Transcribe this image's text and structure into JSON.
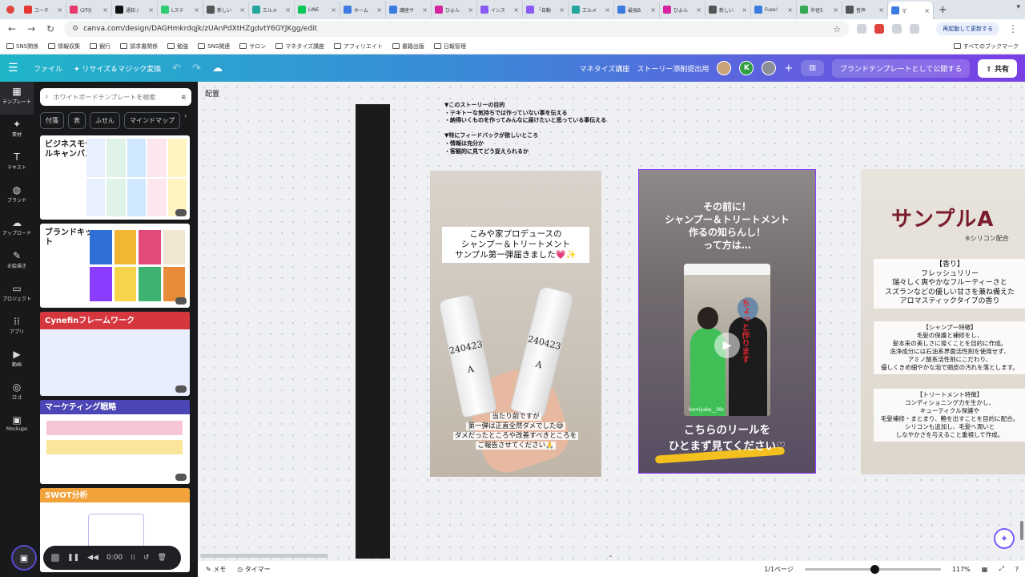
{
  "browser": {
    "tabs": [
      {
        "label": "ユーチ",
        "color": "#e53935"
      },
      {
        "label": "(2刊)",
        "color": "#e53970"
      },
      {
        "label": "通知 /",
        "color": "#111111"
      },
      {
        "label": "Lステ",
        "color": "#2ecc71"
      },
      {
        "label": "新しい",
        "color": "#555555"
      },
      {
        "label": "エルメ",
        "color": "#26a69a"
      },
      {
        "label": "LINE",
        "color": "#06c755"
      },
      {
        "label": "ホーム",
        "color": "#3d7be0"
      },
      {
        "label": "講座サ",
        "color": "#3d7be0"
      },
      {
        "label": "ひよん",
        "color": "#d6249f"
      },
      {
        "label": "インス",
        "color": "#8a5cf6"
      },
      {
        "label": "「自動",
        "color": "#8a5cf6"
      },
      {
        "label": "エルメ",
        "color": "#26a69a"
      },
      {
        "label": "最強B",
        "color": "#3d7be0"
      },
      {
        "label": "ひよん",
        "color": "#d6249f"
      },
      {
        "label": "新しい",
        "color": "#555555"
      },
      {
        "label": "Fuse!",
        "color": "#3d7be0"
      },
      {
        "label": "半径5",
        "color": "#34a853"
      },
      {
        "label": "音声",
        "color": "#555555"
      },
      {
        "label": "マ",
        "color": "#3d7be0"
      }
    ],
    "url": "canva.com/design/DAGHmkrdqjk/zUAnPdXtHZgdvtY6GYJKgg/edit",
    "restart_label": "再起動して更新する",
    "bookmarks": [
      "SNS関係",
      "情報収集",
      "銀行",
      "請求書関係",
      "勉強",
      "SNS関連",
      "サロン",
      "マネタイズ講座",
      "アフィリエイト",
      "書籍出版",
      "日報管理"
    ],
    "all_bookmarks": "すべてのブックマーク"
  },
  "header": {
    "file": "ファイル",
    "resize": "リサイズ＆マジック変換",
    "project": "マネタイズ講座　ストーリー添削提出用",
    "avatar_k": "K",
    "publish": "ブランドテンプレートとして公開する",
    "share": "共有"
  },
  "rail": [
    {
      "label": "テンプレート",
      "icon": "layout-icon",
      "glyph": "▦"
    },
    {
      "label": "素材",
      "icon": "shapes-icon",
      "glyph": "✦"
    },
    {
      "label": "テキスト",
      "icon": "text-icon",
      "glyph": "T"
    },
    {
      "label": "ブランド",
      "icon": "brand-icon",
      "glyph": "◍"
    },
    {
      "label": "アップロード",
      "icon": "cloud-upload-icon",
      "glyph": "☁"
    },
    {
      "label": "お絵描き",
      "icon": "draw-icon",
      "glyph": "✎"
    },
    {
      "label": "プロジェクト",
      "icon": "folder-icon",
      "glyph": "▭"
    },
    {
      "label": "アプリ",
      "icon": "apps-icon",
      "glyph": "⁞⁞"
    },
    {
      "label": "動画",
      "icon": "video-icon",
      "glyph": "▶"
    },
    {
      "label": "ロゴ",
      "icon": "logo-icon",
      "glyph": "◎"
    },
    {
      "label": "Mockups",
      "icon": "mockups-icon",
      "glyph": "▣"
    }
  ],
  "panel": {
    "search_placeholder": "ホワイトボードテンプレートを検索",
    "chips": [
      "付箋",
      "表",
      "ふせん",
      "マインドマップ"
    ],
    "cards": [
      "ビジネスモデルキャンバス",
      "ブランドキット",
      "Cynefinフレームワーク",
      "マーケティング戦略",
      "SWOT分析"
    ]
  },
  "canvas": {
    "arrange": "配置",
    "notes": "▼このストーリーの目的\n・テキトーな気持ちでは作っていない事を伝える\n・納得いくものを作ってみんなに届けたいと思っている事伝える\n\n▼特にフィードバックが欲しいところ\n・情報は充分か\n・客観的に見てどう捉えられるか"
  },
  "slide1": {
    "caption": "こみや家プロデュースの\nシャンプー＆トリートメント\nサンプル第一弾届きました💗✨",
    "bottle_label": "240423\nA",
    "sub": [
      "当たり前ですが",
      "第一弾は正直全然ダメでした😅",
      "ダメだったところや改善すべきところを",
      "ご報告させてください🙏"
    ]
  },
  "slide2": {
    "title": "その前に！\nシャンプー＆トリートメント\n作るの知らんし！\nって方は…",
    "red_text": "ちょっと作ります",
    "handle": "komiyake__life",
    "bottom": "こちらのリールを\nひとまず見てください♡"
  },
  "slide3": {
    "big": "サンプルA",
    "note": "※シリコン配合",
    "scent": "【香り】\nフレッシュリリー\n瑞々しく爽やかなフルーティーさと\nスズランなどの優しい甘さを兼ね備えた\nアロマスティックタイプの香り",
    "shampoo": "【シャンプー特徴】\n毛髪の保護と補修をし、\n髪本来の美しさに導くことを目的に作成。\n洗浄成分には石油系界面活性剤を使用せず、\nアミノ酸系活性剤にこだわり、\n優しくきめ細やかな泡で頭皮の汚れを落とします。",
    "treatment": "【トリートメント特徴】\nコンディショニング力を生かし、\nキューティクル保護や\n毛髪補修・まとまり、艶を出すことを目的に配合。\nシリコンも追加し、毛髪へ潤いと\nしなやかさを与えること重視して作成。"
  },
  "recorder": {
    "time": "0:00"
  },
  "bottom": {
    "memo": "メモ",
    "timer": "タイマー",
    "pages": "1/1ページ",
    "zoom": "117%"
  },
  "colors": {
    "accent": "#8b3dff",
    "header_start": "#1fb6c9",
    "header_end": "#7b3fe4"
  }
}
